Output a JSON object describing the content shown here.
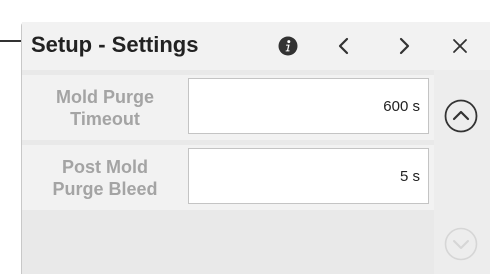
{
  "header": {
    "title": "Setup - Settings",
    "icons": {
      "info": "info-icon",
      "prev": "chevron-left-icon",
      "next": "chevron-right-icon",
      "close": "close-icon"
    }
  },
  "settings": [
    {
      "label": "Mold Purge\nTimeout",
      "value": "600 s"
    },
    {
      "label": "Post Mold\nPurge Bleed",
      "value": "5 s"
    }
  ],
  "scroll": {
    "up_icon": "chevron-up-circle-icon",
    "up_enabled": true,
    "down_icon": "chevron-down-circle-icon",
    "down_enabled": false
  },
  "colors": {
    "panel_bg": "#ededed",
    "label_text": "#a4a4a4",
    "title_text": "#222222",
    "disabled_icon": "#d6d6d6"
  }
}
